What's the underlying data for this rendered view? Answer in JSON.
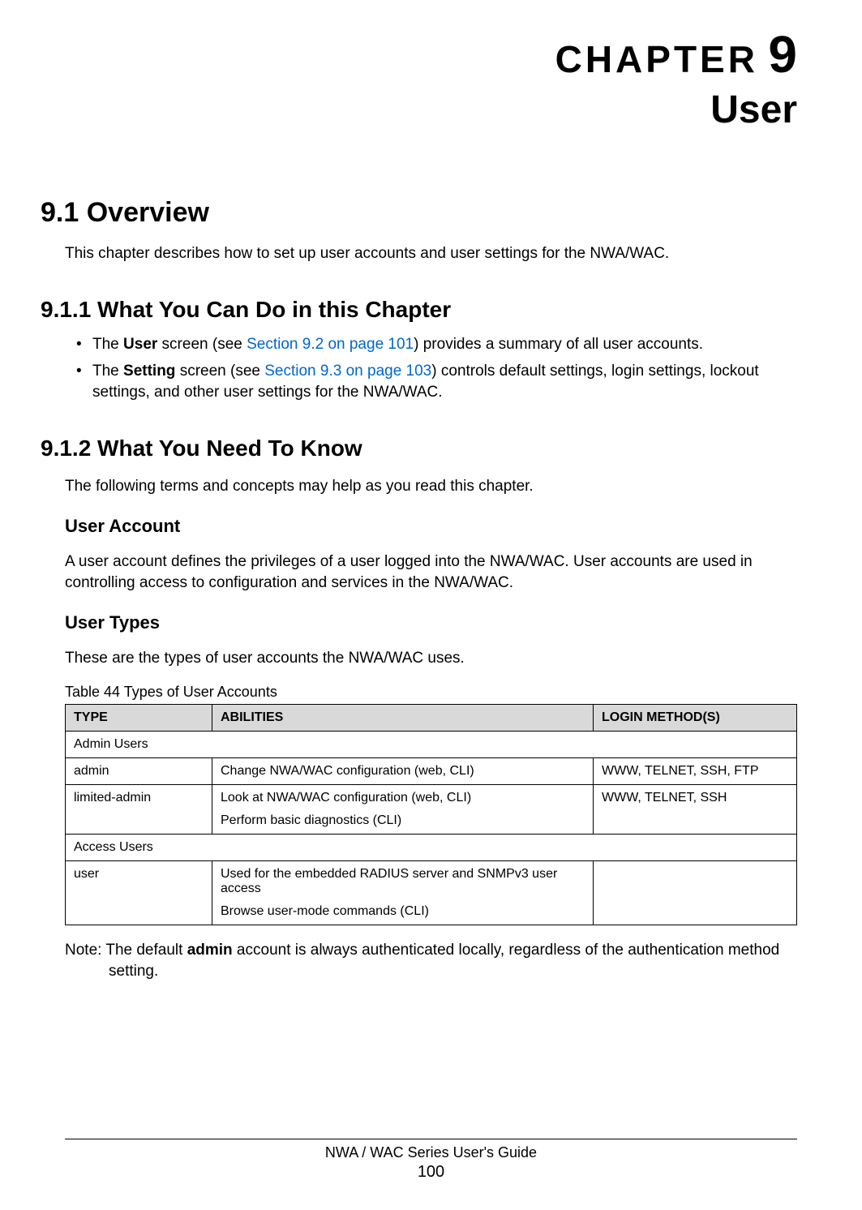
{
  "chapter": {
    "label": "CHAPTER",
    "number": "9",
    "title": "User"
  },
  "s91": {
    "heading": "9.1  Overview",
    "para": "This chapter describes how to set up user accounts and user settings for the NWA/WAC."
  },
  "s911": {
    "heading": "9.1.1  What You Can Do in this Chapter",
    "b1_pre": "The ",
    "b1_bold": "User",
    "b1_mid": " screen (see ",
    "b1_link": "Section 9.2 on page 101",
    "b1_post": ") provides a summary of all user accounts.",
    "b2_pre": "The ",
    "b2_bold": "Setting",
    "b2_mid": " screen (see ",
    "b2_link": "Section 9.3 on page 103",
    "b2_post": ") controls default settings, login settings, lockout settings, and other user settings for the NWA/WAC."
  },
  "s912": {
    "heading": "9.1.2  What You Need To Know",
    "para": "The following terms and concepts may help as you read this chapter."
  },
  "userAccount": {
    "heading": "User Account",
    "para": "A user account defines the privileges of a user logged into the NWA/WAC. User accounts are used in controlling access to configuration and services in the NWA/WAC."
  },
  "userTypes": {
    "heading": "User Types",
    "para": "These are the types of user accounts the NWA/WAC uses."
  },
  "table": {
    "caption": "Table 44   Types of User Accounts",
    "headers": {
      "type": "TYPE",
      "abilities": "ABILITIES",
      "login": "LOGIN METHOD(S)"
    },
    "group1": "Admin Users",
    "row1": {
      "type": "admin",
      "ability": "Change NWA/WAC configuration (web, CLI)",
      "login": "WWW, TELNET, SSH, FTP"
    },
    "row2": {
      "type": "limited-admin",
      "ability1": "Look at NWA/WAC configuration (web, CLI)",
      "ability2": "Perform basic diagnostics (CLI)",
      "login": "WWW, TELNET, SSH"
    },
    "group2": "Access Users",
    "row3": {
      "type": "user",
      "ability1": "Used for the embedded RADIUS server and SNMPv3 user access",
      "ability2": "Browse user-mode commands (CLI)",
      "login": ""
    }
  },
  "note": {
    "prefix": "Note: The default ",
    "bold": "admin",
    "suffix": " account is always authenticated locally, regardless of the authentication method setting."
  },
  "footer": {
    "guide": "NWA / WAC Series User's Guide",
    "page": "100"
  }
}
